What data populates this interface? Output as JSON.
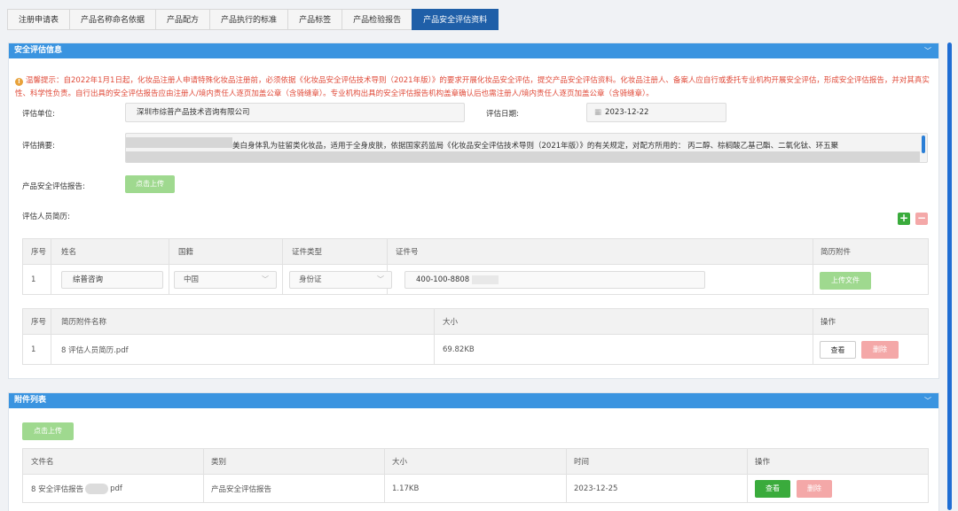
{
  "tabs": [
    {
      "label": "注册申请表"
    },
    {
      "label": "产品名称命名依据"
    },
    {
      "label": "产品配方"
    },
    {
      "label": "产品执行的标准"
    },
    {
      "label": "产品标签"
    },
    {
      "label": "产品检验报告"
    },
    {
      "label": "产品安全评估资料",
      "active": true
    }
  ],
  "safety_panel": {
    "title": "安全评估信息",
    "notice": "温馨提示：自2022年1月1日起，化妆品注册人申请特殊化妆品注册前，必须依据《化妆品安全评估技术导则（2021年版）》的要求开展化妆品安全评估，提交产品安全评估资料。化妆品注册人、备案人应自行或委托专业机构开展安全评估，形成安全评估报告，并对其真实性、科学性负责。自行出具的安全评估报告应由注册人/境内责任人逐页加盖公章（含骑缝章）。专业机构出具的安全评估报告机构盖章确认后也需注册人/境内责任人逐页加盖公章（含骑缝章）。",
    "unit_label": "评估单位:",
    "unit_value": "深圳市综普产品技术咨询有限公司",
    "date_label": "评估日期:",
    "date_value": "2023-12-22",
    "summary_label": "评估摘要:",
    "summary_text": "美白身体乳为驻留类化妆品，适用于全身皮肤，依据国家药监局《化妆品安全评估技术导则（2021年版）》的有关规定，对配方所用的：    丙二醇、棕榈酸乙基己酯、二氧化钛、环五聚",
    "report_label": "产品安全评估报告:",
    "upload_label": "点击上传",
    "resume_label": "评估人员简历:",
    "add_symbol": "+",
    "remove_symbol": "−",
    "person_table": {
      "headers": [
        "序号",
        "姓名",
        "国籍",
        "证件类型",
        "证件号",
        "简历附件"
      ],
      "row": {
        "index": "1",
        "name": "综普咨询",
        "nationality": "中国",
        "id_type": "身份证",
        "id_number": "400-100-8808",
        "upload": "上传文件"
      }
    },
    "resume_table": {
      "headers": [
        "序号",
        "简历附件名称",
        "大小",
        "操作"
      ],
      "row": {
        "index": "1",
        "file": "8 评估人员简历.pdf",
        "size": "69.82KB",
        "view": "查看",
        "delete": "删除"
      }
    }
  },
  "attachment_panel": {
    "title": "附件列表",
    "upload_label": "点击上传",
    "headers": [
      "文件名",
      "类别",
      "大小",
      "时间",
      "操作"
    ],
    "row": {
      "file_prefix": "8 安全评估报告",
      "file_suffix": "pdf",
      "category": "产品安全评估报告",
      "size": "1.17KB",
      "time": "2023-12-25",
      "view": "查看",
      "delete": "删除"
    }
  },
  "colors": {
    "accent": "#3a94e0",
    "tab_active": "#1f5fa8",
    "warning": "#e04b3a",
    "green": "#3aab3c",
    "light_green": "#9fd98f",
    "pink": "#f4a8a8"
  },
  "icons": {
    "collapse": "chevron-down-icon",
    "warning": "warning-icon",
    "calendar": "calendar-icon"
  }
}
